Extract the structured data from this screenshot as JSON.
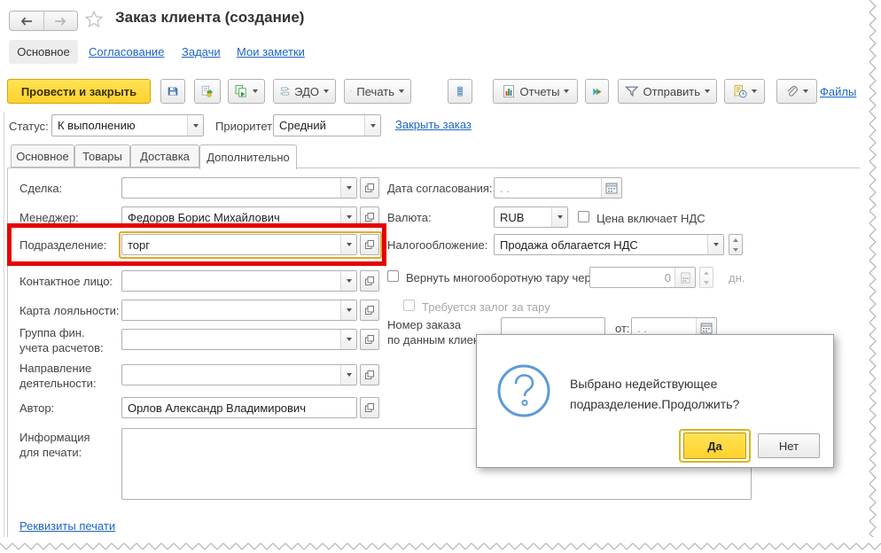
{
  "header": {
    "title": "Заказ клиента (создание)"
  },
  "nav": {
    "main": "Основное",
    "approval": "Согласование",
    "tasks": "Задачи",
    "notes": "Мои заметки"
  },
  "toolbar": {
    "post_and_close": "Провести и закрыть",
    "edo": "ЭДО",
    "print": "Печать",
    "reports": "Отчеты",
    "send": "Отправить",
    "files": "Файлы"
  },
  "status_bar": {
    "status_label": "Статус:",
    "status_value": "К выполнению",
    "priority_label": "Приоритет:",
    "priority_value": "Средний",
    "close_order": "Закрыть заказ"
  },
  "page_tabs": {
    "main": "Основное",
    "goods": "Товары",
    "delivery": "Доставка",
    "additional": "Дополнительно"
  },
  "fields": {
    "deal_label": "Сделка:",
    "manager_label": "Менеджер:",
    "manager_value": "Федоров Борис Михайлович",
    "department_label": "Подразделение:",
    "department_value": "торг",
    "contact_label": "Контактное лицо:",
    "loyalty_label": "Карта лояльности:",
    "fin_group_label": "Группа фин.\nучета расчетов:",
    "activity_label": "Направление\nдеятельности:",
    "author_label": "Автор:",
    "author_value": "Орлов Александр Владимирович",
    "print_info_label": "Информация\nдля печати:",
    "print_details_link": "Реквизиты печати",
    "approval_date_label": "Дата согласования:",
    "approval_date_value": ". .",
    "currency_label": "Валюта:",
    "currency_value": "RUB",
    "vat_included_label": "Цена включает НДС",
    "tax_label": "Налогообложение:",
    "tax_value": "Продажа облагается НДС",
    "tare_return_label": "Вернуть многооборотную тару через:",
    "tare_days_value": "0",
    "tare_days_unit": "дн.",
    "tare_deposit_label": "Требуется залог за тару",
    "client_order_label": "Номер заказа\nпо данным клиента:",
    "client_order_from_label": "от:",
    "client_order_date_value": ". ."
  },
  "dialog": {
    "message": "Выбрано недействующее\nподразделение.Продолжить?",
    "yes": "Да",
    "no": "Нет"
  },
  "colors": {
    "accent_yellow": "#ffd938",
    "highlight_red": "#e60000",
    "link_blue": "#1e64c8",
    "dialog_icon_blue": "#5b9bd8",
    "focus_orange": "#e2aa2a"
  }
}
